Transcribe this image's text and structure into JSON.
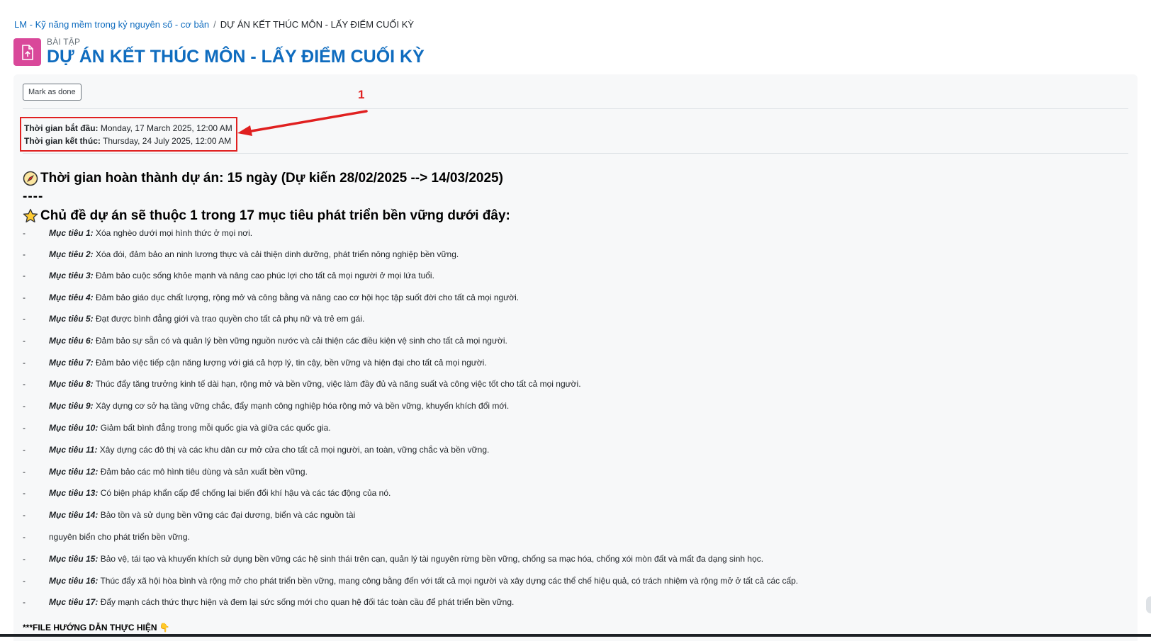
{
  "breadcrumb": {
    "course": "LM - Kỹ năng mềm trong kỷ nguyên số - cơ bản",
    "separator": "/",
    "current": "DỰ ÁN KẾT THÚC MÔN - LẤY ĐIỂM CUỐI KỲ"
  },
  "header": {
    "type_label": "BÀI TẬP",
    "title": "DỰ ÁN KẾT THÚC MÔN - LẤY ĐIỂM CUỐI KỲ",
    "icon": "assignment-upload-icon",
    "icon_color": "#d9489a"
  },
  "completion": {
    "mark_done_label": "Mark as done"
  },
  "dates": {
    "start_label": "Thời gian bắt đầu:",
    "start_value": "Monday, 17 March 2025, 12:00 AM",
    "end_label": "Thời gian kết thúc:",
    "end_value": "Thursday, 24 July 2025, 12:00 AM"
  },
  "annotation": {
    "number": "1",
    "color": "#e02020"
  },
  "content": {
    "duration_heading": "Thời gian hoàn thành dự án: 15 ngày (Dự kiến 28/02/2025 --> 14/03/2025)",
    "separator": "----",
    "topics_heading": "Chủ đề dự án sẽ thuộc 1 trong 17 mục tiêu phát triển bền vững dưới đây:",
    "bullet": "-",
    "goals": [
      {
        "label": "Mục tiêu 1:",
        "text": " Xóa nghèo dưới mọi hình thức ở mọi nơi."
      },
      {
        "label": "Mục tiêu 2:",
        "text": " Xóa đói, đảm bảo an ninh lương thực và cải thiện dinh dưỡng, phát triển nông nghiệp bền vững."
      },
      {
        "label": "Mục tiêu 3:",
        "text": " Đảm bảo cuộc sống khỏe mạnh và nâng cao phúc lợi cho tất cả mọi người ở mọi lứa tuổi."
      },
      {
        "label": "Mục tiêu 4:",
        "text": " Đảm bảo giáo dục chất lượng, rộng mở và công bằng và nâng cao cơ hội học tập suốt đời cho tất cả mọi người."
      },
      {
        "label": "Mục tiêu 5:",
        "text": " Đạt được bình đẳng giới và trao quyền cho tất cả phụ nữ và trẻ em gái."
      },
      {
        "label": "Mục tiêu 6:",
        "text": " Đảm bảo sự sẵn có và quản lý bền vững nguồn nước và cải thiện các điều kiện vệ sinh cho tất cả mọi người."
      },
      {
        "label": "Mục tiêu 7:",
        "text": " Đảm bảo việc tiếp cận năng lượng với giá cả hợp lý, tin cậy, bền vững và hiện đại cho tất cả mọi người."
      },
      {
        "label": "Mục tiêu 8:",
        "text": " Thúc đẩy tăng trưởng kinh tế dài hạn, rộng mở và bền vững, việc làm đầy đủ và năng suất và công việc tốt cho tất cả mọi người."
      },
      {
        "label": "Mục tiêu 9:",
        "text": " Xây dựng cơ sở hạ tầng vững chắc, đẩy mạnh công nghiệp hóa rộng mở và bền vững, khuyến khích đổi mới."
      },
      {
        "label": "Mục tiêu 10:",
        "text": " Giảm bất bình đẳng trong mỗi quốc gia và giữa các quốc gia."
      },
      {
        "label": "Mục tiêu 11:",
        "text": " Xây dựng các đô thị và các khu dân cư mở cửa cho tất cả mọi người, an toàn, vững chắc và bền vững."
      },
      {
        "label": "Mục tiêu 12:",
        "text": " Đảm bảo các mô hình tiêu dùng và sản xuất bền vững."
      },
      {
        "label": "Mục tiêu 13:",
        "text": " Có biện pháp khẩn cấp để chống lại biến đổi khí hậu và các tác động của nó."
      },
      {
        "label": "Mục tiêu 14:",
        "text": " Bảo tồn và sử dụng bền vững các đại dương, biển và các nguồn tài"
      },
      {
        "label": "",
        "text": "nguyên biển cho phát triển bền vững."
      },
      {
        "label": "Mục tiêu 15:",
        "text": " Bảo vệ, tái tạo và khuyến khích sử dụng bền vững các hệ sinh thái trên cạn, quản lý tài nguyên rừng bền vững, chống sa mạc hóa, chống xói mòn đất và mất đa dạng sinh học."
      },
      {
        "label": "Mục tiêu 16:",
        "text": " Thúc đẩy xã hội hòa bình và rộng mở cho phát triển bền vững, mang công bằng đến với tất cả mọi người và xây dựng các thể chế hiệu quả, có trách nhiệm và rộng mở ở tất cả các cấp."
      },
      {
        "label": "Mục tiêu 17:",
        "text": " Đẩy mạnh cách thức thực hiện và đem lại sức sống mới cho quan hệ đối tác toàn cầu để phát triển bền vững."
      }
    ],
    "file_guide": "***FILE HƯỚNG DẪN THỰC HIỆN 👇"
  }
}
